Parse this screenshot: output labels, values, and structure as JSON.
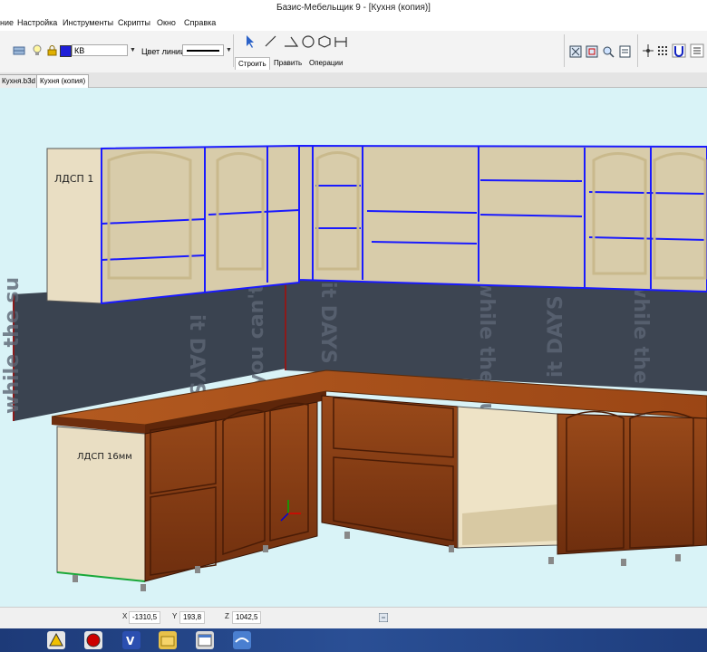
{
  "window": {
    "title": "Базис-Мебельщик 9 - [Кухня (копия)]"
  },
  "menu": {
    "items": [
      "ние",
      "Настройка",
      "Инструменты",
      "Скрипты",
      "Окно",
      "Справка"
    ]
  },
  "toolbar": {
    "layer_value": "КВ",
    "layer_color": "#1e1ed8",
    "line_color_label": "Цвет линии",
    "ribbon_tabs": [
      "Строить",
      "Править",
      "Операции"
    ],
    "active_ribbon_tab": "Строить"
  },
  "document_tabs": {
    "items": [
      "Кухня.b3d",
      "Кухня (копия)"
    ],
    "active": "Кухня (копия)"
  },
  "viewport": {
    "labels": {
      "upper_panel": "ЛДСП 1",
      "lower_panel": "ЛДСП 16мм"
    },
    "colors": {
      "background": "#d9f3f7",
      "selection": "#1a1aff",
      "wood": "#8b3a12",
      "panel": "#e9dec3",
      "backsplash": "#3a4350"
    },
    "backsplash_text": [
      "while the su",
      "it DAYS",
      "you can't have"
    ]
  },
  "status": {
    "x_label": "X",
    "x_value": "-1310,5",
    "y_label": "Y",
    "y_value": "193,8",
    "z_label": "Z",
    "z_value": "1042,5"
  },
  "taskbar": {
    "apps": [
      "autocad-icon",
      "record-icon",
      "visio-icon",
      "folder-icon",
      "explorer-icon",
      "basis-icon"
    ]
  }
}
